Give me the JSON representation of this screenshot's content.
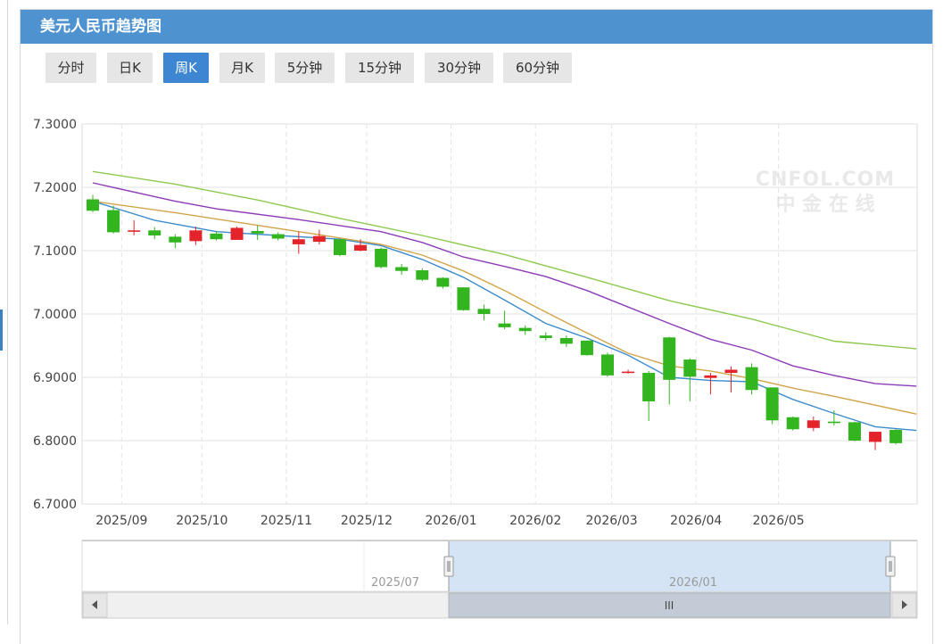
{
  "header": {
    "title": "美元人民币趋势图"
  },
  "tabs": [
    {
      "label": "分时",
      "active": false
    },
    {
      "label": "日K",
      "active": false
    },
    {
      "label": "周K",
      "active": true
    },
    {
      "label": "月K",
      "active": false
    },
    {
      "label": "5分钟",
      "active": false
    },
    {
      "label": "15分钟",
      "active": false
    },
    {
      "label": "30分钟",
      "active": false
    },
    {
      "label": "60分钟",
      "active": false
    }
  ],
  "watermark": {
    "line1": "CNFOL.COM",
    "line2": "中 金 在 线"
  },
  "colors": {
    "up": "#e3242b",
    "down": "#33b51f",
    "ma5": "#3c8ccd",
    "ma10": "#d1a44a",
    "ma20": "#8d3cb8",
    "ma30": "#8ec94e",
    "accent": "#3e86d2"
  },
  "chart_data": {
    "type": "candlestick",
    "ylim": [
      6.7,
      7.3
    ],
    "yticks": [
      "7.3000",
      "7.2000",
      "7.1000",
      "7.0000",
      "6.9000",
      "6.8000",
      "6.7000"
    ],
    "xticks": [
      {
        "label": "2025/09",
        "index": 1.4
      },
      {
        "label": "2025/10",
        "index": 5.3
      },
      {
        "label": "2025/11",
        "index": 9.4
      },
      {
        "label": "2025/12",
        "index": 13.3
      },
      {
        "label": "2026/01",
        "index": 17.4
      },
      {
        "label": "2026/02",
        "index": 21.5
      },
      {
        "label": "2026/03",
        "index": 25.2
      },
      {
        "label": "2026/04",
        "index": 29.3
      },
      {
        "label": "2026/05",
        "index": 33.3
      }
    ],
    "candles": [
      {
        "o": 7.181,
        "h": 7.188,
        "l": 7.161,
        "c": 7.163
      },
      {
        "o": 7.164,
        "h": 7.171,
        "l": 7.127,
        "c": 7.129
      },
      {
        "o": 7.13,
        "h": 7.148,
        "l": 7.124,
        "c": 7.132
      },
      {
        "o": 7.132,
        "h": 7.137,
        "l": 7.118,
        "c": 7.124
      },
      {
        "o": 7.122,
        "h": 7.126,
        "l": 7.104,
        "c": 7.113
      },
      {
        "o": 7.115,
        "h": 7.138,
        "l": 7.109,
        "c": 7.132
      },
      {
        "o": 7.127,
        "h": 7.131,
        "l": 7.116,
        "c": 7.118
      },
      {
        "o": 7.117,
        "h": 7.138,
        "l": 7.117,
        "c": 7.136
      },
      {
        "o": 7.131,
        "h": 7.14,
        "l": 7.117,
        "c": 7.127
      },
      {
        "o": 7.126,
        "h": 7.129,
        "l": 7.116,
        "c": 7.119
      },
      {
        "o": 7.11,
        "h": 7.13,
        "l": 7.095,
        "c": 7.118
      },
      {
        "o": 7.114,
        "h": 7.133,
        "l": 7.11,
        "c": 7.123
      },
      {
        "o": 7.118,
        "h": 7.118,
        "l": 7.091,
        "c": 7.093
      },
      {
        "o": 7.1,
        "h": 7.118,
        "l": 7.099,
        "c": 7.109
      },
      {
        "o": 7.103,
        "h": 7.105,
        "l": 7.072,
        "c": 7.074
      },
      {
        "o": 7.074,
        "h": 7.079,
        "l": 7.062,
        "c": 7.068
      },
      {
        "o": 7.069,
        "h": 7.072,
        "l": 7.052,
        "c": 7.054
      },
      {
        "o": 7.057,
        "h": 7.058,
        "l": 7.04,
        "c": 7.043
      },
      {
        "o": 7.042,
        "h": 7.042,
        "l": 7.005,
        "c": 7.006
      },
      {
        "o": 7.008,
        "h": 7.015,
        "l": 6.99,
        "c": 7.0
      },
      {
        "o": 6.985,
        "h": 7.005,
        "l": 6.976,
        "c": 6.979
      },
      {
        "o": 6.978,
        "h": 6.982,
        "l": 6.967,
        "c": 6.973
      },
      {
        "o": 6.966,
        "h": 6.971,
        "l": 6.958,
        "c": 6.962
      },
      {
        "o": 6.962,
        "h": 6.966,
        "l": 6.948,
        "c": 6.953
      },
      {
        "o": 6.958,
        "h": 6.958,
        "l": 6.934,
        "c": 6.935
      },
      {
        "o": 6.936,
        "h": 6.939,
        "l": 6.901,
        "c": 6.903
      },
      {
        "o": 6.909,
        "h": 6.912,
        "l": 6.906,
        "c": 6.909
      },
      {
        "o": 6.907,
        "h": 6.91,
        "l": 6.831,
        "c": 6.862
      },
      {
        "o": 6.963,
        "h": 6.964,
        "l": 6.857,
        "c": 6.896
      },
      {
        "o": 6.928,
        "h": 6.93,
        "l": 6.862,
        "c": 6.901
      },
      {
        "o": 6.899,
        "h": 6.907,
        "l": 6.873,
        "c": 6.903
      },
      {
        "o": 6.907,
        "h": 6.917,
        "l": 6.876,
        "c": 6.912
      },
      {
        "o": 6.916,
        "h": 6.922,
        "l": 6.873,
        "c": 6.88
      },
      {
        "o": 6.884,
        "h": 6.884,
        "l": 6.826,
        "c": 6.832
      },
      {
        "o": 6.837,
        "h": 6.838,
        "l": 6.816,
        "c": 6.818
      },
      {
        "o": 6.82,
        "h": 6.838,
        "l": 6.815,
        "c": 6.832
      },
      {
        "o": 6.83,
        "h": 6.848,
        "l": 6.824,
        "c": 6.828
      },
      {
        "o": 6.829,
        "h": 6.83,
        "l": 6.799,
        "c": 6.8
      },
      {
        "o": 6.798,
        "h": 6.814,
        "l": 6.785,
        "c": 6.814
      },
      {
        "o": 6.817,
        "h": 6.818,
        "l": 6.794,
        "c": 6.796
      }
    ],
    "moving_averages": [
      {
        "key": "ma5",
        "points": [
          [
            0,
            7.178
          ],
          [
            3,
            7.148
          ],
          [
            6,
            7.13
          ],
          [
            9,
            7.124
          ],
          [
            12,
            7.118
          ],
          [
            14,
            7.108
          ],
          [
            16,
            7.086
          ],
          [
            18,
            7.058
          ],
          [
            20,
            7.022
          ],
          [
            22,
            6.985
          ],
          [
            24,
            6.962
          ],
          [
            26,
            6.935
          ],
          [
            28,
            6.9
          ],
          [
            30,
            6.895
          ],
          [
            32,
            6.893
          ],
          [
            34,
            6.865
          ],
          [
            36,
            6.843
          ],
          [
            38,
            6.822
          ],
          [
            40,
            6.816
          ]
        ]
      },
      {
        "key": "ma10",
        "points": [
          [
            0,
            7.178
          ],
          [
            4,
            7.16
          ],
          [
            8,
            7.14
          ],
          [
            11,
            7.125
          ],
          [
            14,
            7.11
          ],
          [
            16,
            7.093
          ],
          [
            18,
            7.068
          ],
          [
            20,
            7.037
          ],
          [
            22,
            7.003
          ],
          [
            24,
            6.97
          ],
          [
            26,
            6.938
          ],
          [
            28,
            6.918
          ],
          [
            30,
            6.91
          ],
          [
            32,
            6.898
          ],
          [
            34,
            6.883
          ],
          [
            36,
            6.87
          ],
          [
            38,
            6.856
          ],
          [
            40,
            6.842
          ]
        ]
      },
      {
        "key": "ma20",
        "points": [
          [
            0,
            7.207
          ],
          [
            4,
            7.178
          ],
          [
            6,
            7.166
          ],
          [
            10,
            7.149
          ],
          [
            14,
            7.13
          ],
          [
            16,
            7.113
          ],
          [
            18,
            7.09
          ],
          [
            20,
            7.075
          ],
          [
            22,
            7.059
          ],
          [
            24,
            7.037
          ],
          [
            26,
            7.011
          ],
          [
            28,
            6.985
          ],
          [
            30,
            6.96
          ],
          [
            32,
            6.943
          ],
          [
            34,
            6.918
          ],
          [
            36,
            6.903
          ],
          [
            38,
            6.89
          ],
          [
            40,
            6.886
          ]
        ]
      },
      {
        "key": "ma30",
        "points": [
          [
            0,
            7.225
          ],
          [
            4,
            7.205
          ],
          [
            8,
            7.18
          ],
          [
            12,
            7.151
          ],
          [
            16,
            7.124
          ],
          [
            20,
            7.094
          ],
          [
            24,
            7.058
          ],
          [
            28,
            7.021
          ],
          [
            32,
            6.992
          ],
          [
            36,
            6.957
          ],
          [
            40,
            6.945
          ]
        ]
      }
    ],
    "navigator": {
      "labels": [
        {
          "label": "2025/07"
        },
        {
          "label": "2026/01"
        }
      ],
      "handle_grip": "III"
    }
  }
}
